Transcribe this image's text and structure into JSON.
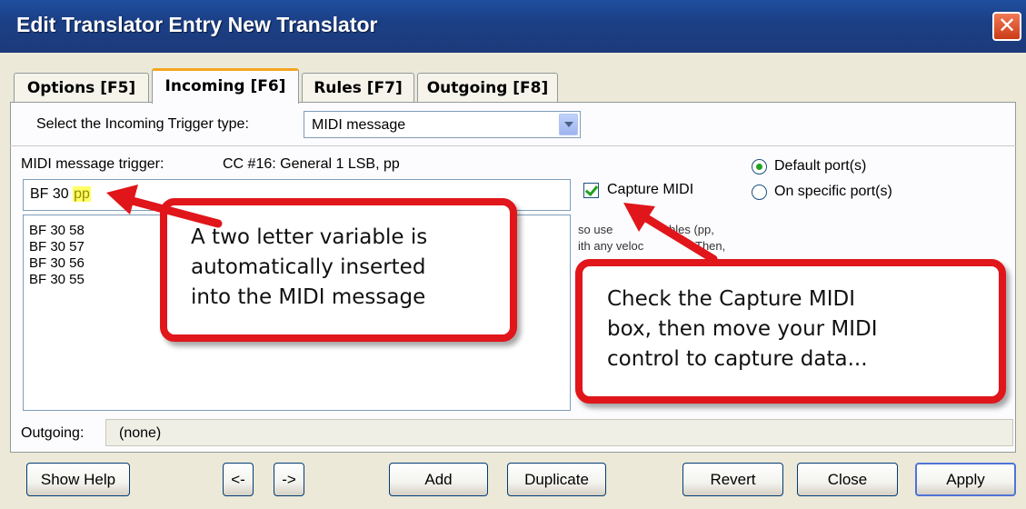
{
  "window": {
    "title": "Edit Translator Entry New Translator",
    "close_glyph": "✕"
  },
  "tabs": [
    {
      "label": "Options [F5]"
    },
    {
      "label": "Incoming [F6]"
    },
    {
      "label": "Rules [F7]"
    },
    {
      "label": "Outgoing [F8]"
    }
  ],
  "incoming": {
    "trigger_type_label": "Select the Incoming Trigger type:",
    "trigger_type_value": "MIDI message",
    "midi_trigger_label": "MIDI message trigger:",
    "midi_trigger_desc": "CC #16: General 1 LSB, pp",
    "trigger_prefix": "BF 30 ",
    "trigger_variable": "pp",
    "captured": [
      "BF 30 58",
      "BF 30 57",
      "BF 30 56",
      "BF 30 55"
    ],
    "capture_label": "Capture MIDI",
    "capture_checked": true,
    "port_default": "Default port(s)",
    "port_specific": "On specific port(s)",
    "hidden_help_1": "so use",
    "hidden_help_2": "bles (pp,",
    "hidden_help_3": "ith any veloc",
    "hidden_help_4": "Then,"
  },
  "outgoing": {
    "label": "Outgoing:",
    "value": "(none)"
  },
  "buttons": {
    "show_help": "Show Help",
    "prev": "<-",
    "next": "->",
    "add": "Add",
    "duplicate": "Duplicate",
    "revert": "Revert",
    "close": "Close",
    "apply": "Apply"
  },
  "callouts": {
    "left": "A two letter variable is\nautomatically  inserted\ninto the MIDI message",
    "right": "Check the Capture MIDI\nbox, then move your MIDI\ncontrol to capture data..."
  },
  "colors": {
    "title_bar": "#1d3a7a",
    "callout_border": "#E0161B",
    "highlight": "#FFFF66",
    "check_green": "#21A121"
  }
}
